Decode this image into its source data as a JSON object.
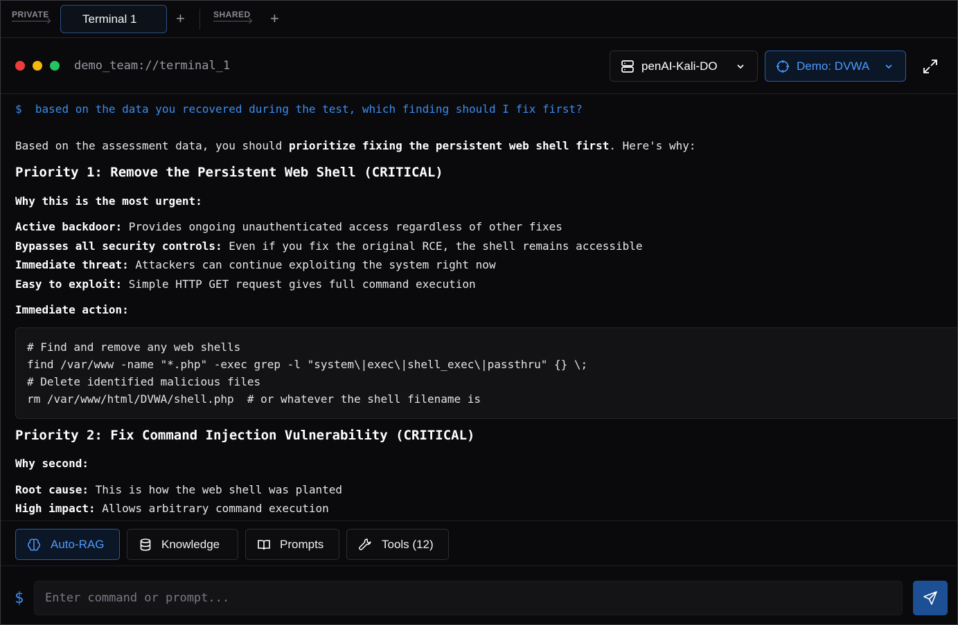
{
  "tabs": {
    "private_label": "PRIVATE",
    "shared_label": "SHARED",
    "active_tab": "Terminal 1",
    "add_symbol": "+"
  },
  "terminal": {
    "path": "demo_team://terminal_1",
    "server": "penAI-Kali-DO",
    "target": "Demo: DVWA"
  },
  "output": {
    "command_prefix": "$",
    "command": "based on the data you recovered during the test, which finding should I fix first?",
    "intro_a": "Based on the assessment data, you should ",
    "intro_b": "prioritize fixing the persistent web shell first",
    "intro_c": ". Here's why:",
    "p1_heading": "Priority 1: Remove the Persistent Web Shell (CRITICAL)",
    "p1_why": "Why this is the most urgent:",
    "p1_items": [
      {
        "label": "Active backdoor:",
        "text": " Provides ongoing unauthenticated access regardless of other fixes"
      },
      {
        "label": "Bypasses all security controls:",
        "text": " Even if you fix the original RCE, the shell remains accessible"
      },
      {
        "label": "Immediate threat:",
        "text": " Attackers can continue exploiting the system right now"
      },
      {
        "label": "Easy to exploit:",
        "text": " Simple HTTP GET request gives full command execution"
      }
    ],
    "p1_action": "Immediate action:",
    "code_lines": [
      "# Find and remove any web shells",
      "find /var/www -name \"*.php\" -exec grep -l \"system\\|exec\\|shell_exec\\|passthru\" {} \\;",
      "# Delete identified malicious files",
      "rm /var/www/html/DVWA/shell.php  # or whatever the shell filename is"
    ],
    "p2_heading": "Priority 2: Fix Command Injection Vulnerability (CRITICAL)",
    "p2_why": "Why second:",
    "p2_items": [
      {
        "label": "Root cause:",
        "text": " This is how the web shell was planted"
      },
      {
        "label": "High impact:",
        "text": " Allows arbitrary command execution"
      }
    ]
  },
  "toolbar": {
    "auto_rag": "Auto-RAG",
    "knowledge": "Knowledge",
    "prompts": "Prompts",
    "tools": "Tools (12)"
  },
  "input": {
    "prompt_symbol": "$",
    "placeholder": "Enter command or prompt...",
    "value": ""
  },
  "colors": {
    "accent": "#3b8cf0",
    "background": "#0a0a0c",
    "dot_red": "#ef3b3b",
    "dot_yellow": "#f5b70f",
    "dot_green": "#22c55e"
  }
}
